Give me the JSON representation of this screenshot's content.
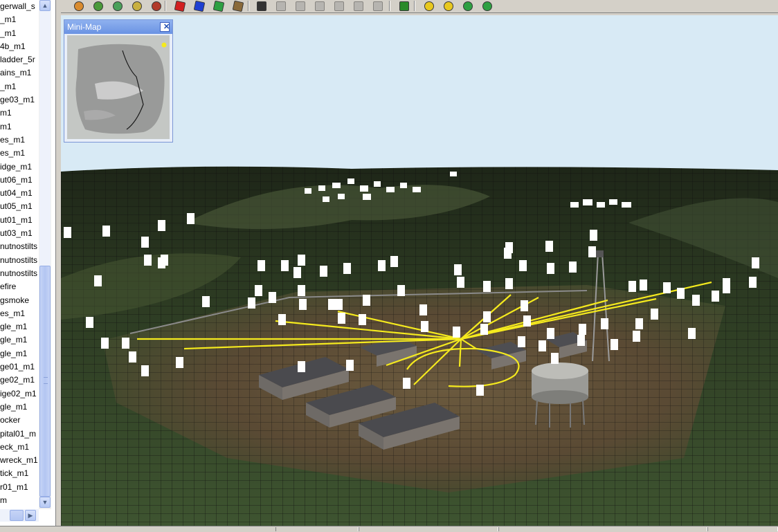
{
  "object_list": {
    "items": [
      "gerwall_s",
      "_m1",
      "_m1",
      "4b_m1",
      "ladder_5r",
      "ains_m1",
      "_m1",
      "ge03_m1",
      "m1",
      "m1",
      "es_m1",
      "es_m1",
      "idge_m1",
      "ut06_m1",
      "ut04_m1",
      "ut05_m1",
      "ut01_m1",
      "ut03_m1",
      "nutnostilts",
      "nutnostilts",
      "nutnostilts",
      "efire",
      "gsmoke",
      "es_m1",
      "gle_m1",
      "gle_m1",
      "gle_m1",
      "ge01_m1",
      "ge02_m1",
      "ige02_m1",
      "gle_m1",
      "ocker",
      "pital01_m",
      "eck_m1",
      "wreck_m1",
      "tick_m1",
      "r01_m1",
      "m"
    ]
  },
  "minimap": {
    "title": "Mini-Map",
    "close_label": "✕"
  },
  "colors": {
    "sky": "#d8eaf5",
    "terrain": "#3a4a2c",
    "wireframe": "#111111",
    "link_lines": "#f5ea1e",
    "minimap_titlebar": "#7aa0e8"
  },
  "toolbar": {
    "icons": [
      "house-icon",
      "globe-icon",
      "layers-icon",
      "bulb-icon",
      "power-icon",
      "red-cube-icon",
      "blue-cube-icon",
      "green-cube-icon",
      "brown-cube-icon",
      "pointer-icon",
      "move-icon",
      "move-down-icon",
      "rotate-icon",
      "rotate-alt-icon",
      "rotate-back-icon",
      "scale-icon",
      "drop-icon",
      "lock-icon",
      "lock-open-icon",
      "green-circle-icon",
      "green-circle-alt-icon"
    ]
  }
}
